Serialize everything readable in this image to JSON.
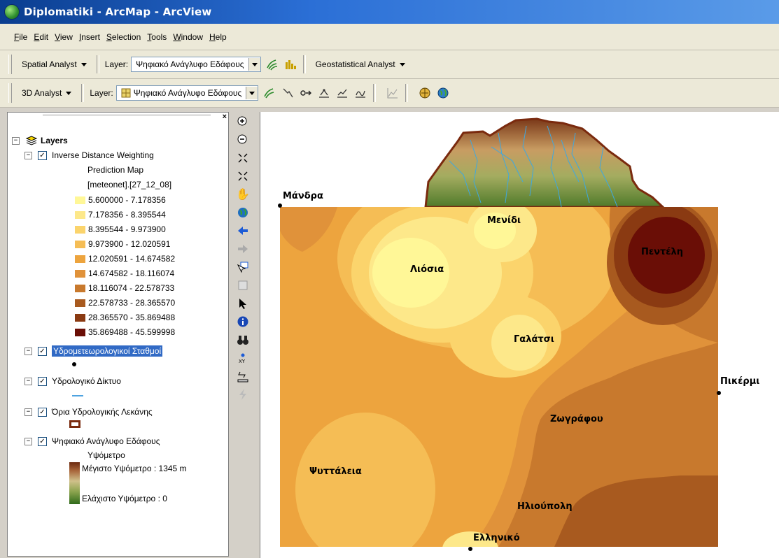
{
  "window": {
    "title": "Diplomatiki - ArcMap - ArcView"
  },
  "menu": [
    "File",
    "Edit",
    "View",
    "Insert",
    "Selection",
    "Tools",
    "Window",
    "Help"
  ],
  "toolbar1": {
    "spatial_analyst": "Spatial Analyst",
    "layer_label": "Layer:",
    "layer_value": "Ψηφιακό Ανάγλυφο Εδάφους",
    "geostat": "Geostatistical Analyst"
  },
  "toolbar2": {
    "analyst_3d": "3D Analyst",
    "layer_label": "Layer:",
    "layer_value": "Ψηφιακό Ανάγλυφο Εδάφους"
  },
  "toc": {
    "root": "Layers",
    "layer1": {
      "name": "Inverse Distance Weighting",
      "sub1": "Prediction Map",
      "sub2": "[meteonet].[27_12_08]",
      "classes": [
        {
          "range": "5.600000 - 7.178356",
          "color": "#fff797"
        },
        {
          "range": "7.178356 - 8.395544",
          "color": "#fde88a"
        },
        {
          "range": "8.395544 - 9.973900",
          "color": "#fbd46c"
        },
        {
          "range": "9.973900 - 12.020591",
          "color": "#f5bd55"
        },
        {
          "range": "12.020591 - 14.674582",
          "color": "#eda43e"
        },
        {
          "range": "14.674582 - 18.116074",
          "color": "#e0923a"
        },
        {
          "range": "18.116074 - 22.578733",
          "color": "#c8792d"
        },
        {
          "range": "22.578733 - 28.365570",
          "color": "#a85a1f"
        },
        {
          "range": "28.365570 - 35.869488",
          "color": "#8a3a12"
        },
        {
          "range": "35.869488 - 45.599998",
          "color": "#6a0e06"
        }
      ]
    },
    "layer2": {
      "name": "Υδρομετεωρολογικοί Σταθμοί"
    },
    "layer3": {
      "name": "Υδρολογικό Δίκτυο"
    },
    "layer4": {
      "name": "Όρια Υδρολογικής Λεκάνης"
    },
    "layer5": {
      "name": "Ψηφιακό Ανάγλυφο Εδάφους",
      "sub": "Υψόμετρο",
      "max": "Μέγιστο Υψόμετρο : 1345 m",
      "min": "Ελάχιστο Υψόμετρο : 0"
    }
  },
  "map": {
    "labels": {
      "mandra": "Μάνδρα",
      "menidi": "Μενίδι",
      "liosia": "Λιόσια",
      "penteli": "Πεντέλη",
      "galatsi": "Γαλάτσι",
      "pikermi": "Πικέρμι",
      "zografou": "Ζωγράφου",
      "psyttaleia": "Ψυττάλεια",
      "ilioupoli": "Ηλιούπολη",
      "elliniko": "Ελληνικό"
    }
  }
}
